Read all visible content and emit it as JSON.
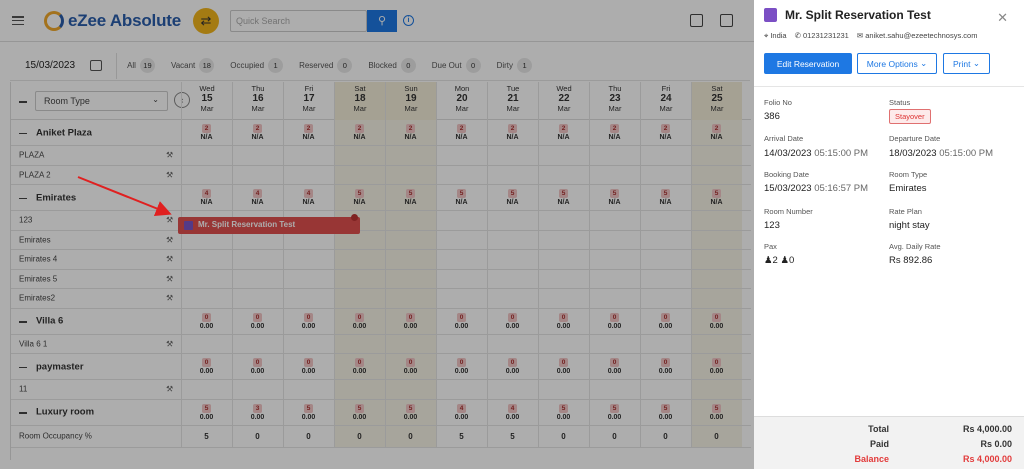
{
  "app": {
    "name": "eZee Absolute",
    "search_placeholder": "Quick Search"
  },
  "filters": {
    "date": "15/03/2023",
    "items": [
      {
        "label": "All",
        "count": "19"
      },
      {
        "label": "Vacant",
        "count": "18"
      },
      {
        "label": "Occupied",
        "count": "1"
      },
      {
        "label": "Reserved",
        "count": "0"
      },
      {
        "label": "Blocked",
        "count": "0"
      },
      {
        "label": "Due Out",
        "count": "0"
      },
      {
        "label": "Dirty",
        "count": "1"
      }
    ]
  },
  "grid": {
    "room_type_select": "Room Type",
    "days": [
      {
        "dow": "Wed",
        "day": "15",
        "mon": "Mar"
      },
      {
        "dow": "Thu",
        "day": "16",
        "mon": "Mar"
      },
      {
        "dow": "Fri",
        "day": "17",
        "mon": "Mar"
      },
      {
        "dow": "Sat",
        "day": "18",
        "mon": "Mar"
      },
      {
        "dow": "Sun",
        "day": "19",
        "mon": "Mar"
      },
      {
        "dow": "Mon",
        "day": "20",
        "mon": "Mar"
      },
      {
        "dow": "Tue",
        "day": "21",
        "mon": "Mar"
      },
      {
        "dow": "Wed",
        "day": "22",
        "mon": "Mar"
      },
      {
        "dow": "Thu",
        "day": "23",
        "mon": "Mar"
      },
      {
        "dow": "Fri",
        "day": "24",
        "mon": "Mar"
      },
      {
        "dow": "Sat",
        "day": "25",
        "mon": "Mar"
      }
    ],
    "groups": [
      {
        "name": "Aniket Plaza",
        "avail": [
          "2",
          "2",
          "2",
          "2",
          "2",
          "2",
          "2",
          "2",
          "2",
          "2",
          "2"
        ],
        "rate": "N/A",
        "rooms": [
          "PLAZA",
          "PLAZA 2"
        ]
      },
      {
        "name": "Emirates",
        "avail": [
          "4",
          "4",
          "4",
          "5",
          "5",
          "5",
          "5",
          "5",
          "5",
          "5",
          "5"
        ],
        "rate": "N/A",
        "rooms": [
          "123",
          "Emirates",
          "Emirates 4",
          "Emirates 5",
          "Emirates2"
        ]
      },
      {
        "name": "Villa 6",
        "avail": [
          "0",
          "0",
          "0",
          "0",
          "0",
          "0",
          "0",
          "0",
          "0",
          "0",
          "0"
        ],
        "rate": "0.00",
        "rooms": [
          "Villa 6 1"
        ]
      },
      {
        "name": "paymaster",
        "avail": [
          "0",
          "0",
          "0",
          "0",
          "0",
          "0",
          "0",
          "0",
          "0",
          "0",
          "0"
        ],
        "rate": "0.00",
        "rooms": [
          "11"
        ]
      },
      {
        "name": "Luxury room",
        "avail": [
          "5",
          "3",
          "5",
          "5",
          "5",
          "4",
          "4",
          "5",
          "5",
          "5",
          "5"
        ],
        "rate": "0.00",
        "rooms": []
      }
    ],
    "occupancy_label": "Room Occupancy %",
    "occupancy": [
      "5",
      "0",
      "0",
      "0",
      "0",
      "5",
      "5",
      "0",
      "0",
      "0",
      "0"
    ],
    "reservation_label": "Mr. Split Reservation Test"
  },
  "panel": {
    "title": "Mr. Split Reservation Test",
    "country": "India",
    "phone": "01231231231",
    "email": "aniket.sahu@ezeetechnosys.com",
    "btn_edit": "Edit Reservation",
    "btn_more": "More Options",
    "btn_print": "Print",
    "folio_label": "Folio No",
    "folio": "386",
    "status_label": "Status",
    "status": "Stayover",
    "arrival_label": "Arrival Date",
    "arrival_date": "14/03/2023",
    "arrival_time": "05:15:00 PM",
    "departure_label": "Departure Date",
    "departure_date": "18/03/2023",
    "departure_time": "05:15:00 PM",
    "booking_label": "Booking Date",
    "booking_date": "15/03/2023",
    "booking_time": "05:16:57 PM",
    "roomtype_label": "Room Type",
    "roomtype": "Emirates",
    "roomno_label": "Room Number",
    "roomno": "123",
    "rateplan_label": "Rate Plan",
    "rateplan": "night stay",
    "pax_label": "Pax",
    "adults": "2",
    "children": "0",
    "adr_label": "Avg. Daily Rate",
    "adr": "Rs 892.86",
    "total_label": "Total",
    "total": "Rs 4,000.00",
    "paid_label": "Paid",
    "paid": "Rs 0.00",
    "balance_label": "Balance",
    "balance": "Rs 4,000.00"
  }
}
